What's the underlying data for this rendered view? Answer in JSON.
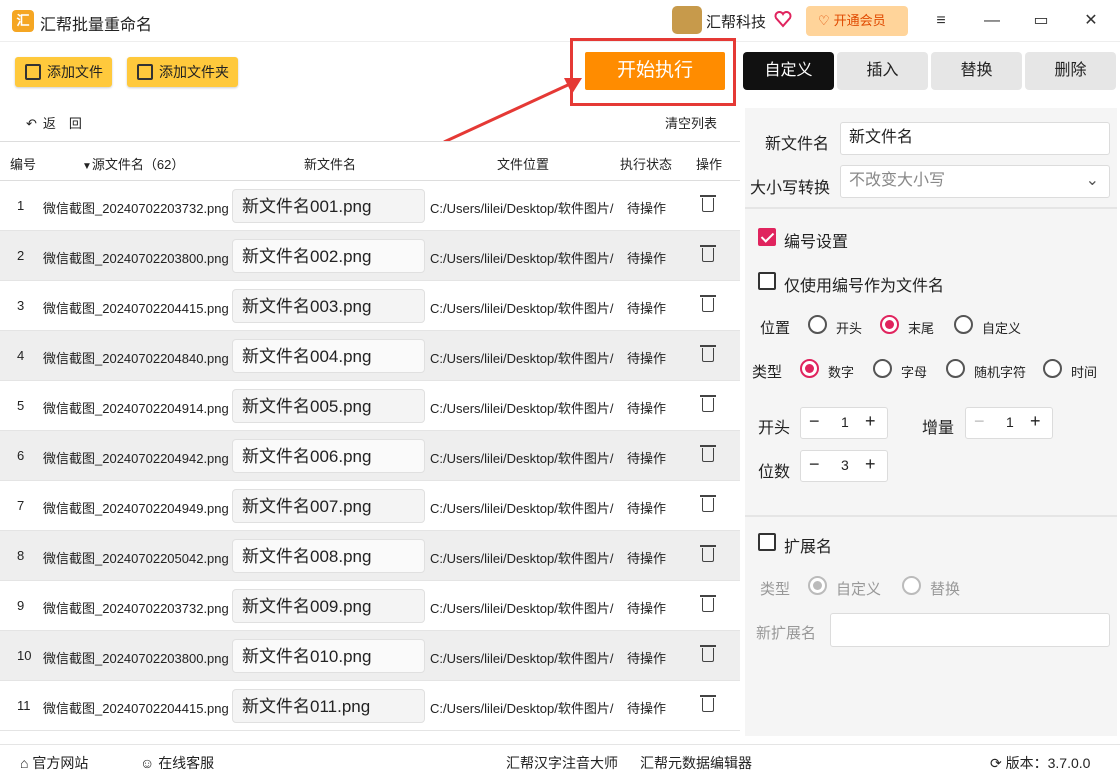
{
  "app": {
    "title": "汇帮批量重命名",
    "company": "汇帮科技",
    "vip_label": "开通会员"
  },
  "toolbar": {
    "add_file": "添加文件",
    "add_folder": "添加文件夹",
    "start": "开始执行",
    "back": "返　回",
    "clear_list": "清空列表"
  },
  "tabs": [
    {
      "label": "自定义",
      "active": true
    },
    {
      "label": "插入",
      "active": false
    },
    {
      "label": "替换",
      "active": false
    },
    {
      "label": "删除",
      "active": false
    }
  ],
  "table": {
    "headers": {
      "index": "编号",
      "source": "源文件名（62）",
      "newname": "新文件名",
      "location": "文件位置",
      "status": "执行状态",
      "action": "操作"
    },
    "rows": [
      {
        "index": "1",
        "source": "微信截图_20240702203732.png",
        "newname": "新文件名001.png",
        "location": "C:/Users/lilei/Desktop/软件图片/",
        "status": "待操作"
      },
      {
        "index": "2",
        "source": "微信截图_20240702203800.png",
        "newname": "新文件名002.png",
        "location": "C:/Users/lilei/Desktop/软件图片/",
        "status": "待操作"
      },
      {
        "index": "3",
        "source": "微信截图_20240702204415.png",
        "newname": "新文件名003.png",
        "location": "C:/Users/lilei/Desktop/软件图片/",
        "status": "待操作"
      },
      {
        "index": "4",
        "source": "微信截图_20240702204840.png",
        "newname": "新文件名004.png",
        "location": "C:/Users/lilei/Desktop/软件图片/",
        "status": "待操作"
      },
      {
        "index": "5",
        "source": "微信截图_20240702204914.png",
        "newname": "新文件名005.png",
        "location": "C:/Users/lilei/Desktop/软件图片/",
        "status": "待操作"
      },
      {
        "index": "6",
        "source": "微信截图_20240702204942.png",
        "newname": "新文件名006.png",
        "location": "C:/Users/lilei/Desktop/软件图片/",
        "status": "待操作"
      },
      {
        "index": "7",
        "source": "微信截图_20240702204949.png",
        "newname": "新文件名007.png",
        "location": "C:/Users/lilei/Desktop/软件图片/",
        "status": "待操作"
      },
      {
        "index": "8",
        "source": "微信截图_20240702205042.png",
        "newname": "新文件名008.png",
        "location": "C:/Users/lilei/Desktop/软件图片/",
        "status": "待操作"
      },
      {
        "index": "9",
        "source": "微信截图_20240702203732.png",
        "newname": "新文件名009.png",
        "location": "C:/Users/lilei/Desktop/软件图片/",
        "status": "待操作"
      },
      {
        "index": "10",
        "source": "微信截图_20240702203800.png",
        "newname": "新文件名010.png",
        "location": "C:/Users/lilei/Desktop/软件图片/",
        "status": "待操作"
      },
      {
        "index": "11",
        "source": "微信截图_20240702204415.png",
        "newname": "新文件名011.png",
        "location": "C:/Users/lilei/Desktop/软件图片/",
        "status": "待操作"
      }
    ]
  },
  "panel": {
    "newname_label": "新文件名",
    "newname_value": "新文件名",
    "case_label": "大小写转换",
    "case_value": "不改变大小写",
    "numbering_label": "编号设置",
    "numbering_checked": true,
    "only_number_label": "仅使用编号作为文件名",
    "only_number_checked": false,
    "position_label": "位置",
    "position_options": [
      "开头",
      "末尾",
      "自定义"
    ],
    "position_selected": "末尾",
    "type_label": "类型",
    "type_options": [
      "数字",
      "字母",
      "随机字符",
      "时间"
    ],
    "type_selected": "数字",
    "start_label": "开头",
    "start_value": "1",
    "step_label": "增量",
    "step_value": "1",
    "digits_label": "位数",
    "digits_value": "3",
    "ext_label": "扩展名",
    "ext_checked": false,
    "ext_type_label": "类型",
    "ext_type_options": [
      "自定义",
      "替换"
    ],
    "ext_type_selected": "自定义",
    "new_ext_label": "新扩展名",
    "new_ext_value": ""
  },
  "statusbar": {
    "website": "官方网站",
    "support": "在线客服",
    "product1": "汇帮汉字注音大师",
    "product2": "汇帮元数据编辑器",
    "version": "版本：3.7.0.0"
  },
  "colors": {
    "accent": "#ff8c00",
    "toolbar_button": "#ffc93c",
    "checkbox": "#e0245e",
    "highlight_frame": "#e53935"
  }
}
